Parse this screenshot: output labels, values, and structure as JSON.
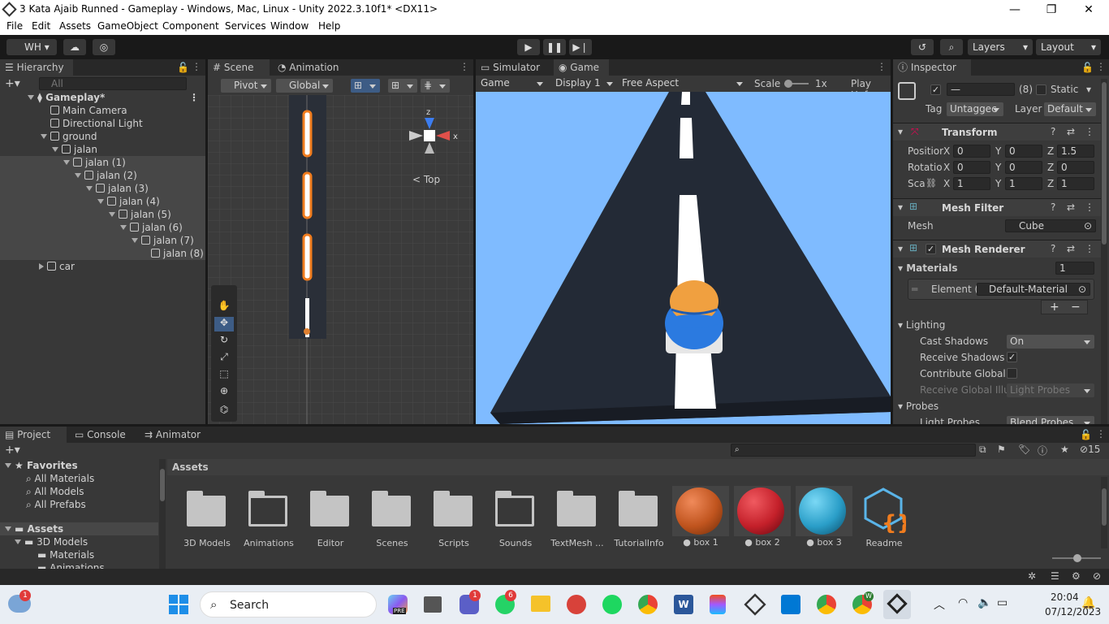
{
  "window": {
    "title": "3 Kata Ajaib Runned - Gameplay - Windows, Mac, Linux - Unity 2022.3.10f1* <DX11>",
    "min": "—",
    "max": "❐",
    "close": "✕"
  },
  "menu": [
    "File",
    "Edit",
    "Assets",
    "GameObject",
    "Component",
    "Services",
    "Window",
    "Help"
  ],
  "toolbar": {
    "account": "WH",
    "layers": "Layers",
    "layout": "Layout"
  },
  "hierarchy": {
    "tab": "Hierarchy",
    "search_placeholder": "All",
    "scene": "Gameplay*",
    "items": [
      "Main Camera",
      "Directional Light",
      "ground",
      "jalan",
      "jalan (1)",
      "jalan (2)",
      "jalan (3)",
      "jalan (4)",
      "jalan (5)",
      "jalan (6)",
      "jalan (7)",
      "jalan (8)",
      "car"
    ]
  },
  "scene": {
    "tab_scene": "Scene",
    "tab_animation": "Animation",
    "pivot": "Pivot",
    "global": "Global",
    "gizmo_view": "Top",
    "axis_z": "z",
    "axis_x": "x"
  },
  "game": {
    "tab_simulator": "Simulator",
    "tab_game": "Game",
    "display_mode": "Game",
    "display": "Display 1",
    "aspect": "Free Aspect",
    "scale_label": "Scale",
    "scale_value": "1x",
    "play_unfocused": "Play Unf"
  },
  "inspector": {
    "tab": "Inspector",
    "name": "—",
    "count": "(8)",
    "static": "Static",
    "tag_label": "Tag",
    "tag": "Untaggec",
    "layer_label": "Layer",
    "layer": "Default",
    "transform": {
      "title": "Transform",
      "position_label": "Positior",
      "rotation_label": "Rotatio",
      "scale_label": "Sca",
      "position": {
        "x": "0",
        "y": "0",
        "z": "1.5"
      },
      "rotation": {
        "x": "0",
        "y": "0",
        "z": "0"
      },
      "scale": {
        "x": "1",
        "y": "1",
        "z": "1"
      }
    },
    "mesh_filter": {
      "title": "Mesh Filter",
      "mesh_label": "Mesh",
      "mesh": "Cube"
    },
    "mesh_renderer": {
      "title": "Mesh Renderer",
      "materials_label": "Materials",
      "materials_count": "1",
      "element_label": "Element (",
      "element": "Default-Material",
      "lighting_label": "Lighting",
      "cast_shadows_label": "Cast Shadows",
      "cast_shadows": "On",
      "receive_shadows_label": "Receive Shadows",
      "contribute_label": "Contribute Global I",
      "receive_gi_label": "Receive Global Illu",
      "receive_gi": "Light Probes",
      "probes_label": "Probes",
      "light_probes_label": "Light Probes",
      "light_probes": "Blend Probes"
    }
  },
  "project": {
    "tab_project": "Project",
    "tab_console": "Console",
    "tab_animator": "Animator",
    "hidden_count": "15",
    "favorites": {
      "label": "Favorites",
      "items": [
        "All Materials",
        "All Models",
        "All Prefabs"
      ]
    },
    "tree": {
      "assets": "Assets",
      "models": "3D Models",
      "materials": "Materials",
      "animations": "Animations"
    },
    "breadcrumb": "Assets",
    "assets": [
      "3D Models",
      "Animations",
      "Editor",
      "Scenes",
      "Scripts",
      "Sounds",
      "TextMesh ...",
      "TutorialInfo",
      "box 1",
      "box 2",
      "box 3",
      "Readme"
    ],
    "sphere_colors": [
      "#c0541e",
      "#c4202a",
      "#2a9ec8"
    ]
  },
  "taskbar": {
    "search": "Search",
    "time": "20:04",
    "date": "07/12/2023",
    "badge_weather": "1",
    "badge_teams": "1",
    "badge_whatsapp": "6",
    "badge_chrome_w": "W",
    "badge_copilot": "PRE"
  },
  "colors": {
    "sky": "#7fbbff",
    "road": "#232a36",
    "accent": "#f07c1e"
  }
}
